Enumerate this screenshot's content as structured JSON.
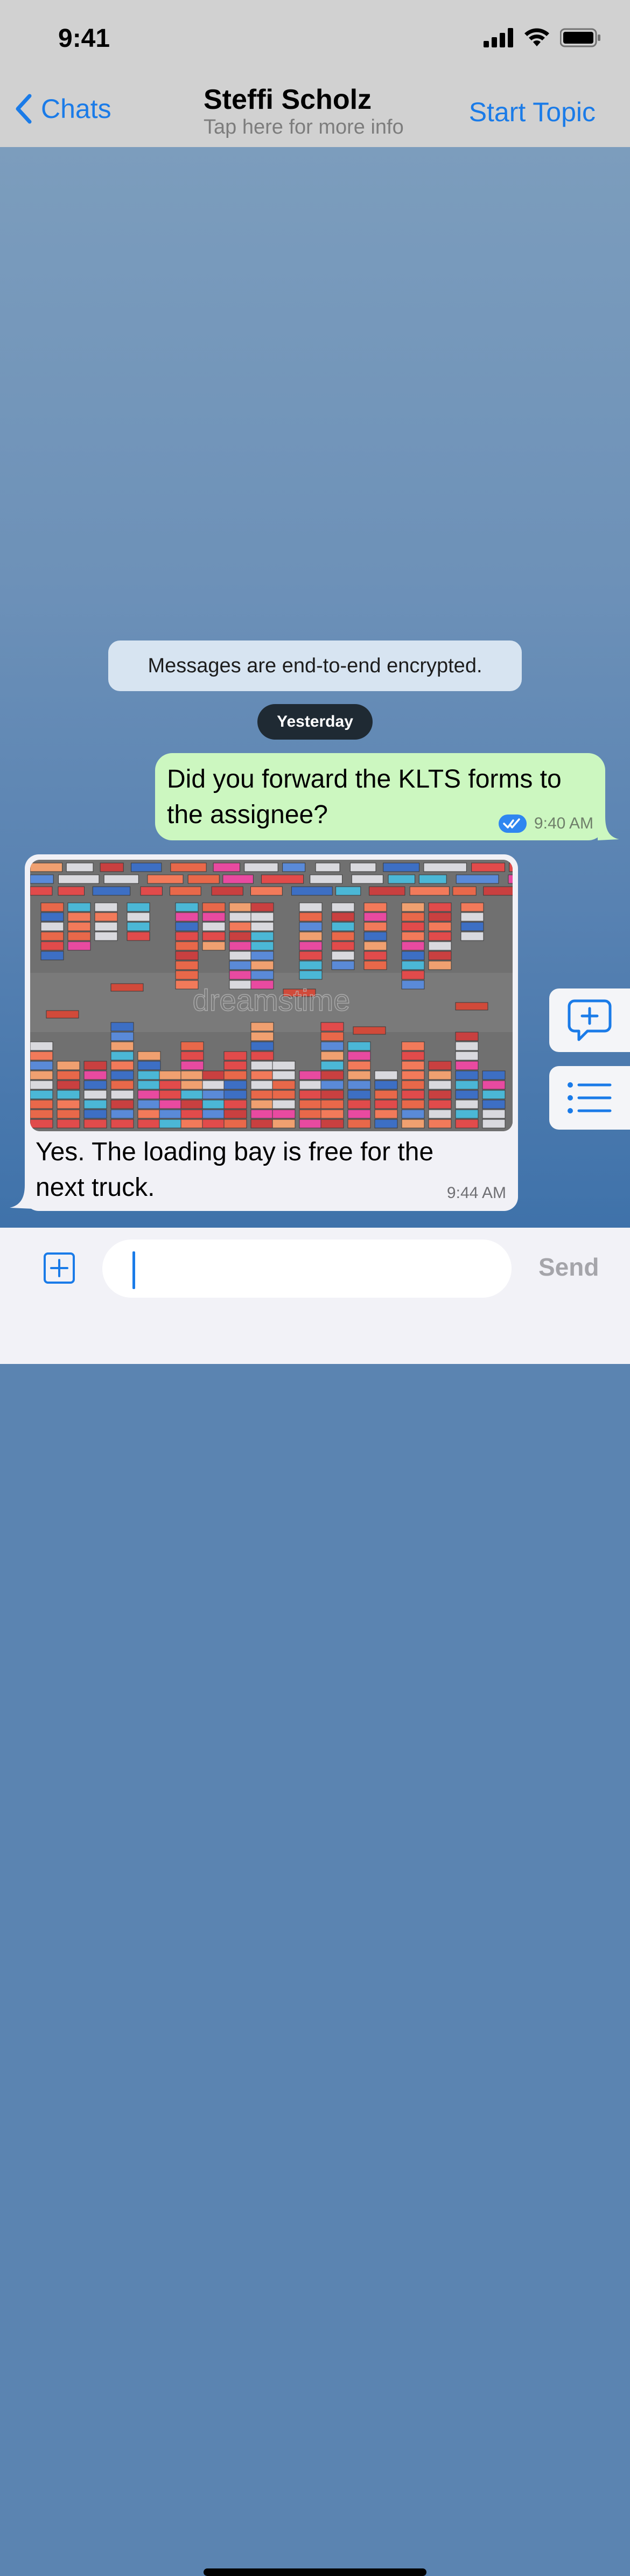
{
  "status": {
    "time": "9:41"
  },
  "nav": {
    "back_label": "Chats",
    "title": "Steffi Scholz",
    "subtitle": "Tap here for more info",
    "action_label": "Start Topic"
  },
  "chat": {
    "encryption_notice": "Messages are end-to-end encrypted.",
    "date_label": "Yesterday",
    "messages": [
      {
        "direction": "outgoing",
        "text": "Did you forward the KLTS forms to the assignee?",
        "time": "9:40 AM",
        "status": "read"
      },
      {
        "direction": "incoming",
        "has_image": true,
        "image_watermark": "dreamstime",
        "text": "Yes. The loading bay is free for the next truck.",
        "time": "9:44 AM"
      }
    ]
  },
  "composer": {
    "placeholder": "",
    "value": "",
    "send_label": "Send"
  },
  "icons": {
    "back": "chevron-left-icon",
    "read_receipt": "double-check-icon",
    "new_topic": "chat-plus-icon",
    "topics_list": "list-icon",
    "attach": "plus-square-icon"
  },
  "colors": {
    "accent": "#1a7be8",
    "outgoing_bubble": "#ccf7c0",
    "incoming_bubble": "#f1f1f6",
    "bar_bg": "#d1d1d1"
  }
}
